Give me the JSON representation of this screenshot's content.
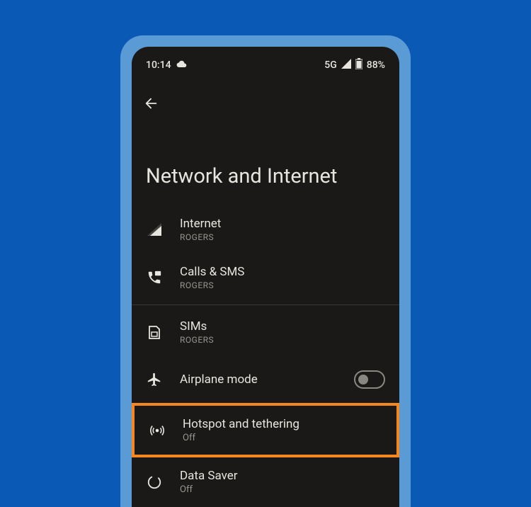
{
  "status": {
    "time": "10:14",
    "network": "5G",
    "battery": "88%"
  },
  "page": {
    "title": "Network and Internet"
  },
  "items": {
    "internet": {
      "title": "Internet",
      "subtitle": "ROGERS"
    },
    "calls": {
      "title": "Calls & SMS",
      "subtitle": "ROGERS"
    },
    "sims": {
      "title": "SIMs",
      "subtitle": "ROGERS"
    },
    "airplane": {
      "title": "Airplane mode"
    },
    "hotspot": {
      "title": "Hotspot and tethering",
      "subtitle": "Off"
    },
    "datasaver": {
      "title": "Data Saver",
      "subtitle": "Off"
    }
  }
}
